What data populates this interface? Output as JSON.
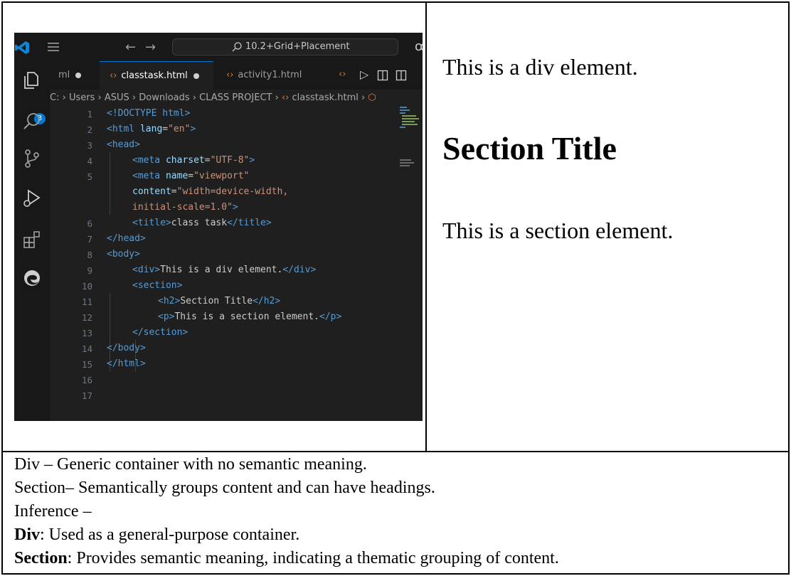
{
  "vscode": {
    "search_text": "10.2+Grid+Placement",
    "explorer_badge": "3",
    "tabs": [
      {
        "label": "ml"
      },
      {
        "label": "classtask.html"
      },
      {
        "label": "activity1.html"
      }
    ],
    "breadcrumb": [
      "C:",
      "Users",
      "ASUS",
      "Downloads",
      "CLASS PROJECT",
      "classtask.html"
    ],
    "line_numbers": [
      "1",
      "2",
      "3",
      "4",
      "5",
      "6",
      "7",
      "8",
      "9",
      "10",
      "11",
      "12",
      "13",
      "14",
      "15",
      "16",
      "17"
    ],
    "code": {
      "l1_tag": "<!DOCTYPE html>",
      "l2_open": "<html",
      "l2_attr": "lang",
      "l2_val": "\"en\"",
      "l3": "<head>",
      "l4_open": "<meta",
      "l4_attr": "charset",
      "l4_val": "\"UTF-8\"",
      "l5_open": "<meta",
      "l5_attr": "name",
      "l5_val": "\"viewport\"",
      "l5b_attr": "content",
      "l5b_val": "\"width=device-width,",
      "l5c_val": "initial-scale=1.0\"",
      "l6_open": "<title>",
      "l6_text": "class task",
      "l6_close": "</title>",
      "l7": "</head>",
      "l8": "<body>",
      "l9_open": "<div>",
      "l9_text": "This is a div element.",
      "l9_close": "</div>",
      "l10": "<section>",
      "l11_open": "<h2>",
      "l11_text": "Section Title",
      "l11_close": "</h2>",
      "l12_open": "<p>",
      "l12_text": "This is a section element.",
      "l12_close": "</p>",
      "l13": "</section>",
      "l14": "</body>",
      "l15": "</html>"
    }
  },
  "output": {
    "div_text": "This is a div element.",
    "section_title": "Section Title",
    "section_text": "This is a section element."
  },
  "notes": {
    "line1": "Div – Generic container with no semantic meaning.",
    "line2": "Section– Semantically groups content and can have headings.",
    "line3": "Inference –",
    "line4_term": "Div",
    "line4_text": ": Used as a general-purpose container.",
    "line5_term": "Section",
    "line5_text": ": Provides semantic meaning, indicating a thematic grouping of content."
  },
  "colors": {
    "editor_bg": "#1f1f1f",
    "tag": "#569cd6",
    "attribute": "#9cdcfe",
    "string": "#ce9178",
    "accent": "#0078d4"
  }
}
